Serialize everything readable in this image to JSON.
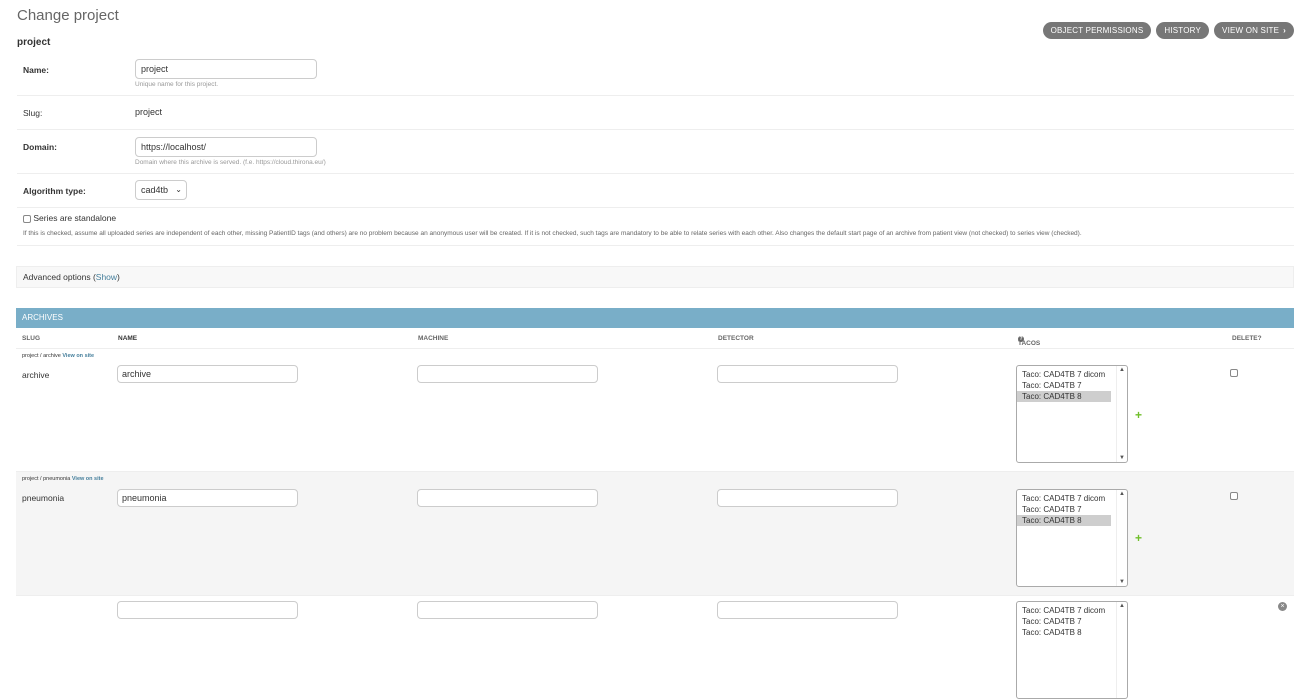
{
  "page": {
    "title": "Change project",
    "object_name": "project",
    "tools": {
      "permissions": "OBJECT PERMISSIONS",
      "history": "HISTORY",
      "view_on_site": "VIEW ON SITE"
    }
  },
  "form": {
    "name_label": "Name:",
    "name_value": "project",
    "name_help": "Unique name for this project.",
    "slug_label": "Slug:",
    "slug_value": "project",
    "domain_label": "Domain:",
    "domain_value": "https://localhost/",
    "domain_help": "Domain where this archive is served. (f.e. https://cloud.thirona.eu/)",
    "algorithm_label": "Algorithm type:",
    "algorithm_value": "cad4tb",
    "standalone_label": "Series are standalone",
    "standalone_help": "If this is checked, assume all uploaded series are independent of each other, missing PatientID tags (and others) are no problem because an anonymous user will be created. If it is not checked, such tags are mandatory to be able to relate series with each other. Also changes the default start page of an archive from patient view (not checked) to series view (checked)."
  },
  "advanced": {
    "label": "Advanced options (",
    "link": "Show",
    "suffix": ")"
  },
  "archives": {
    "title": "ARCHIVES",
    "columns": {
      "slug": "SLUG",
      "name": "NAME",
      "machine": "MACHINE",
      "detector": "DETECTOR",
      "tacos": "TACOS",
      "delete": "DELETE?"
    },
    "view_on_site": "View on site",
    "taco_options": [
      "Taco: CAD4TB 7 dicom",
      "Taco: CAD4TB 7",
      "Taco: CAD4TB 8"
    ],
    "rows": [
      {
        "original": "project / archive",
        "slug": "archive",
        "name": "archive",
        "machine": "",
        "detector": ""
      },
      {
        "original": "project / pneumonia",
        "slug": "pneumonia",
        "name": "pneumonia",
        "machine": "",
        "detector": ""
      },
      {
        "original": "",
        "slug": "",
        "name": "",
        "machine": "",
        "detector": ""
      }
    ]
  }
}
